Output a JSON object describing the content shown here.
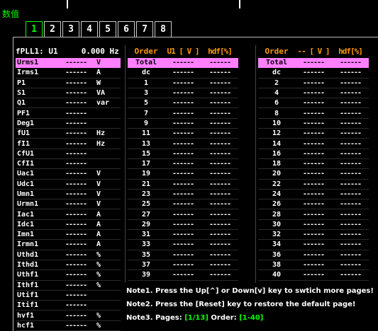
{
  "window": {
    "title": "数值"
  },
  "tabs": [
    "1",
    "2",
    "3",
    "4",
    "5",
    "6",
    "7",
    "8"
  ],
  "active_tab": "1",
  "left_panel": {
    "header": "fPLL1: U1     0.000 Hz",
    "rows": [
      {
        "name": "Urms1",
        "value": "------",
        "unit": "V",
        "highlight": true
      },
      {
        "name": "Irms1",
        "value": "------",
        "unit": "A"
      },
      {
        "name": "P1",
        "value": "------",
        "unit": "W"
      },
      {
        "name": "S1",
        "value": "------",
        "unit": "VA"
      },
      {
        "name": "Q1",
        "value": "------",
        "unit": "var"
      },
      {
        "name": "PF1",
        "value": "------",
        "unit": ""
      },
      {
        "name": "Deg1",
        "value": "------",
        "unit": ""
      },
      {
        "name": "fU1",
        "value": "------",
        "unit": "Hz"
      },
      {
        "name": "fI1",
        "value": "------",
        "unit": "Hz"
      },
      {
        "name": "CfU1",
        "value": "------",
        "unit": ""
      },
      {
        "name": "CfI1",
        "value": "------",
        "unit": ""
      },
      {
        "name": "Uac1",
        "value": "------",
        "unit": "V"
      },
      {
        "name": "Udc1",
        "value": "------",
        "unit": "V"
      },
      {
        "name": "Umn1",
        "value": "------",
        "unit": "V"
      },
      {
        "name": "Urmn1",
        "value": "------",
        "unit": "V"
      },
      {
        "name": "Iac1",
        "value": "------",
        "unit": "A"
      },
      {
        "name": "Idc1",
        "value": "------",
        "unit": "A"
      },
      {
        "name": "Imn1",
        "value": "------",
        "unit": "A"
      },
      {
        "name": "Irmn1",
        "value": "------",
        "unit": "A"
      },
      {
        "name": "Uthd1",
        "value": "------",
        "unit": "%"
      },
      {
        "name": "Ithd1",
        "value": "------",
        "unit": "%"
      },
      {
        "name": "Uthf1",
        "value": "------",
        "unit": "%"
      },
      {
        "name": "Ithf1",
        "value": "------",
        "unit": "%"
      },
      {
        "name": "Utif1",
        "value": "------",
        "unit": ""
      },
      {
        "name": "Itif1",
        "value": "------",
        "unit": ""
      },
      {
        "name": "hvf1",
        "value": "------",
        "unit": "%"
      },
      {
        "name": "hcf1",
        "value": "------",
        "unit": "%"
      }
    ]
  },
  "order_table_1": {
    "headers": [
      "Order",
      "U1 [ V ]",
      "hdf[%]"
    ],
    "rows": [
      {
        "order": "Total",
        "v": "------",
        "h": "------",
        "highlight": true
      },
      {
        "order": "dc",
        "v": "------",
        "h": "------"
      },
      {
        "order": "1",
        "v": "------",
        "h": "------"
      },
      {
        "order": "3",
        "v": "------",
        "h": "------"
      },
      {
        "order": "5",
        "v": "------",
        "h": "------"
      },
      {
        "order": "7",
        "v": "------",
        "h": "------"
      },
      {
        "order": "9",
        "v": "------",
        "h": "------"
      },
      {
        "order": "11",
        "v": "------",
        "h": "------"
      },
      {
        "order": "13",
        "v": "------",
        "h": "------"
      },
      {
        "order": "15",
        "v": "------",
        "h": "------"
      },
      {
        "order": "17",
        "v": "------",
        "h": "------"
      },
      {
        "order": "19",
        "v": "------",
        "h": "------"
      },
      {
        "order": "21",
        "v": "------",
        "h": "------"
      },
      {
        "order": "23",
        "v": "------",
        "h": "------"
      },
      {
        "order": "25",
        "v": "------",
        "h": "------"
      },
      {
        "order": "27",
        "v": "------",
        "h": "------"
      },
      {
        "order": "29",
        "v": "------",
        "h": "------"
      },
      {
        "order": "31",
        "v": "------",
        "h": "------"
      },
      {
        "order": "33",
        "v": "------",
        "h": "------"
      },
      {
        "order": "35",
        "v": "------",
        "h": "------"
      },
      {
        "order": "37",
        "v": "------",
        "h": "------"
      },
      {
        "order": "39",
        "v": "------",
        "h": "------"
      }
    ]
  },
  "order_table_2": {
    "headers": [
      "Order",
      "-- [ V ]",
      "hdf[%]"
    ],
    "rows": [
      {
        "order": "Total",
        "v": "------",
        "h": "------",
        "highlight": true
      },
      {
        "order": "dc",
        "v": "------",
        "h": "------"
      },
      {
        "order": "2",
        "v": "------",
        "h": "------"
      },
      {
        "order": "4",
        "v": "------",
        "h": "------"
      },
      {
        "order": "6",
        "v": "------",
        "h": "------"
      },
      {
        "order": "8",
        "v": "------",
        "h": "------"
      },
      {
        "order": "10",
        "v": "------",
        "h": "------"
      },
      {
        "order": "12",
        "v": "------",
        "h": "------"
      },
      {
        "order": "14",
        "v": "------",
        "h": "------"
      },
      {
        "order": "16",
        "v": "------",
        "h": "------"
      },
      {
        "order": "18",
        "v": "------",
        "h": "------"
      },
      {
        "order": "20",
        "v": "------",
        "h": "------"
      },
      {
        "order": "22",
        "v": "------",
        "h": "------"
      },
      {
        "order": "24",
        "v": "------",
        "h": "------"
      },
      {
        "order": "26",
        "v": "------",
        "h": "------"
      },
      {
        "order": "28",
        "v": "------",
        "h": "------"
      },
      {
        "order": "30",
        "v": "------",
        "h": "------"
      },
      {
        "order": "32",
        "v": "------",
        "h": "------"
      },
      {
        "order": "34",
        "v": "------",
        "h": "------"
      },
      {
        "order": "36",
        "v": "------",
        "h": "------"
      },
      {
        "order": "38",
        "v": "------",
        "h": "------"
      },
      {
        "order": "40",
        "v": "------",
        "h": "------"
      }
    ]
  },
  "notes": {
    "note1": "Note1. Press the Up[^] or Down[v] key to swtich more pages!",
    "note2": "Note2. Press the [Reset] key to restore the default page!",
    "note3_prefix": "Note3. Pages: ",
    "pages": "[1/13]",
    "order_label": "  Order: ",
    "order_range": "[1-40]"
  },
  "colors": {
    "accent": "#00ff00",
    "header": "#ff9900",
    "highlight": "#ff80ff"
  }
}
